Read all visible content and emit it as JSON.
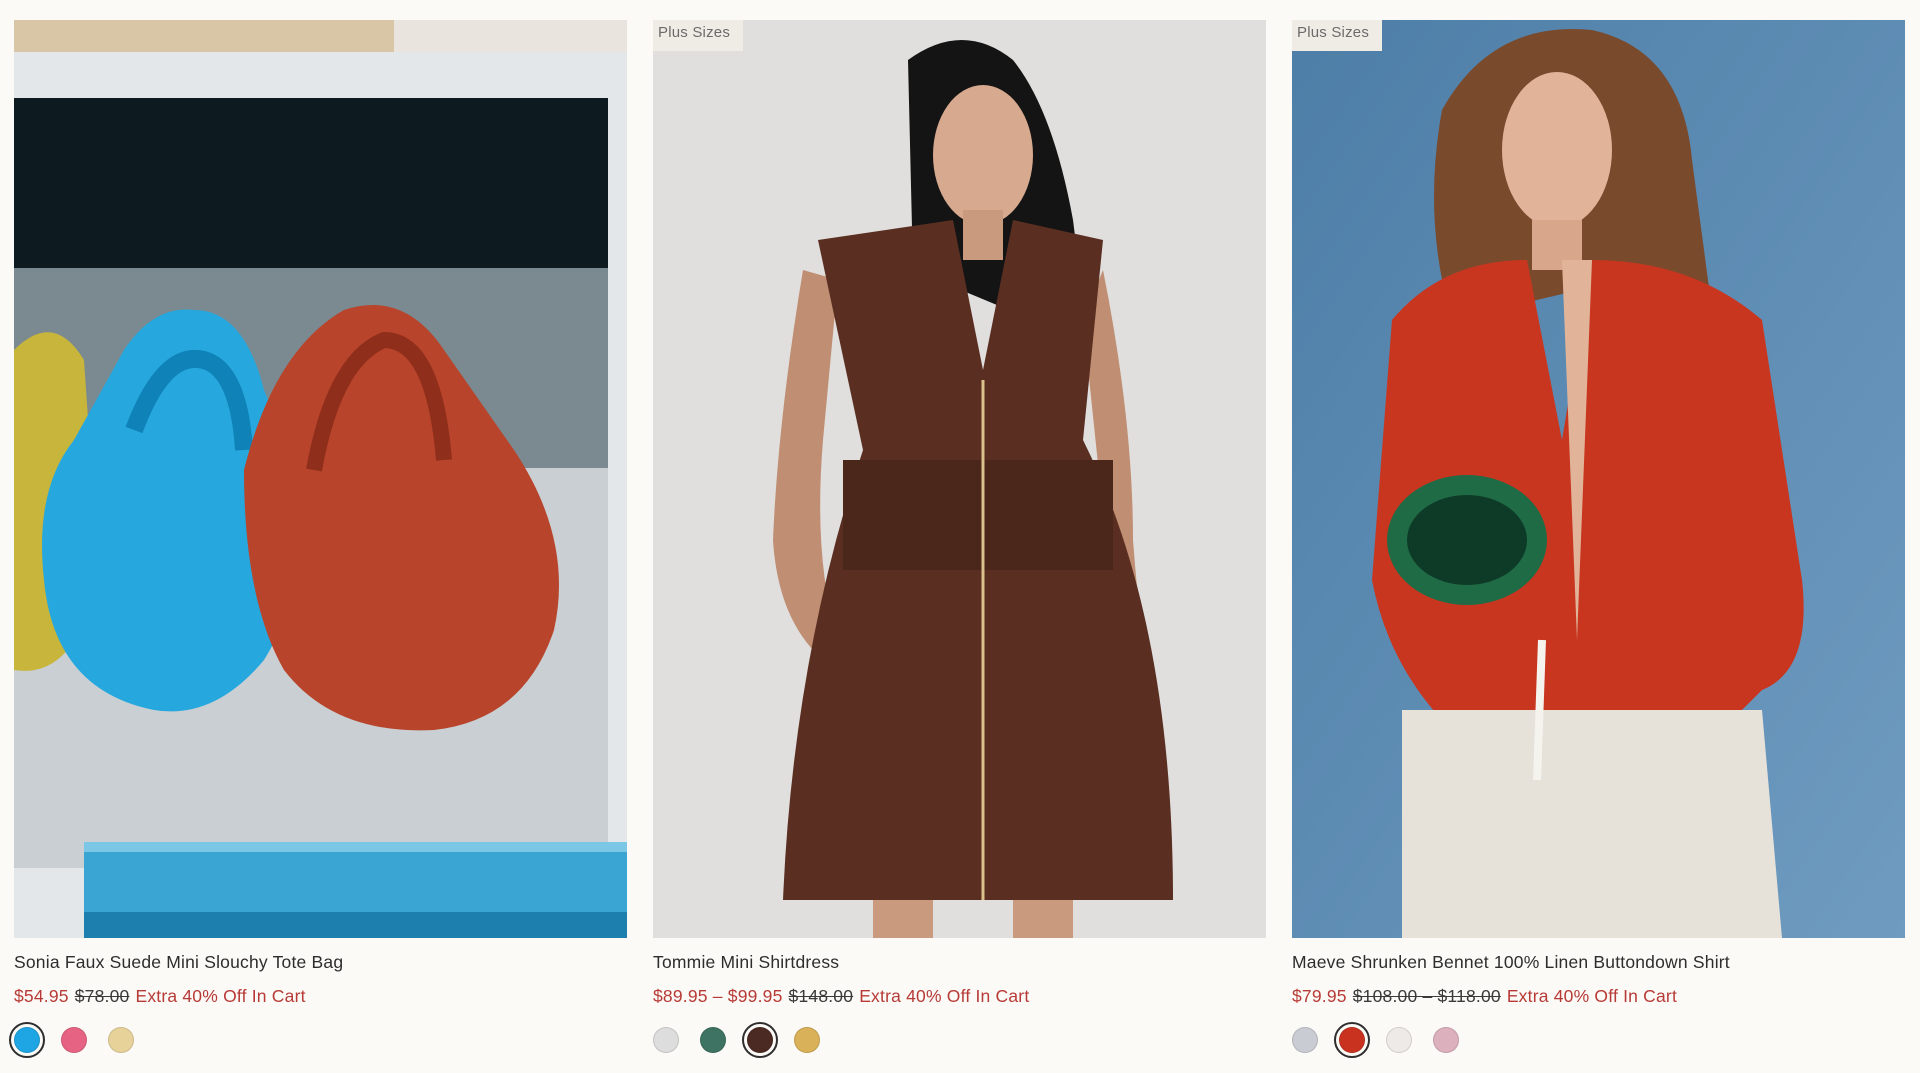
{
  "products": [
    {
      "name": "Sonia Faux Suede Mini Slouchy Tote Bag",
      "sale_price": "$54.95",
      "original_price": "$78.00",
      "promo": "Extra 40% Off In Cart",
      "swatches": [
        "#1ea6e4",
        "#e66384",
        "#e7d29a"
      ],
      "selected_swatch": 0
    },
    {
      "badge": "Plus Sizes",
      "name": "Tommie Mini Shirtdress",
      "sale_price": "$89.95 – $99.95",
      "original_price": "$148.00",
      "promo": "Extra 40% Off In Cart",
      "swatches": [
        "#dedddd",
        "#3e7363",
        "#4a2a22",
        "#d9b158"
      ],
      "selected_swatch": 2
    },
    {
      "badge": "Plus Sizes",
      "name": "Maeve Shrunken Bennet 100% Linen Buttondown Shirt",
      "sale_price": "$79.95",
      "original_price": "$108.00 – $118.00",
      "promo": "Extra 40% Off In Cart",
      "swatches": [
        "#c9ccd3",
        "#c9321f",
        "#eeeae8",
        "#ddb0bd"
      ],
      "selected_swatch": 1
    }
  ],
  "colors": {
    "sale": "#b73a37",
    "background": "#fbfaf6"
  }
}
